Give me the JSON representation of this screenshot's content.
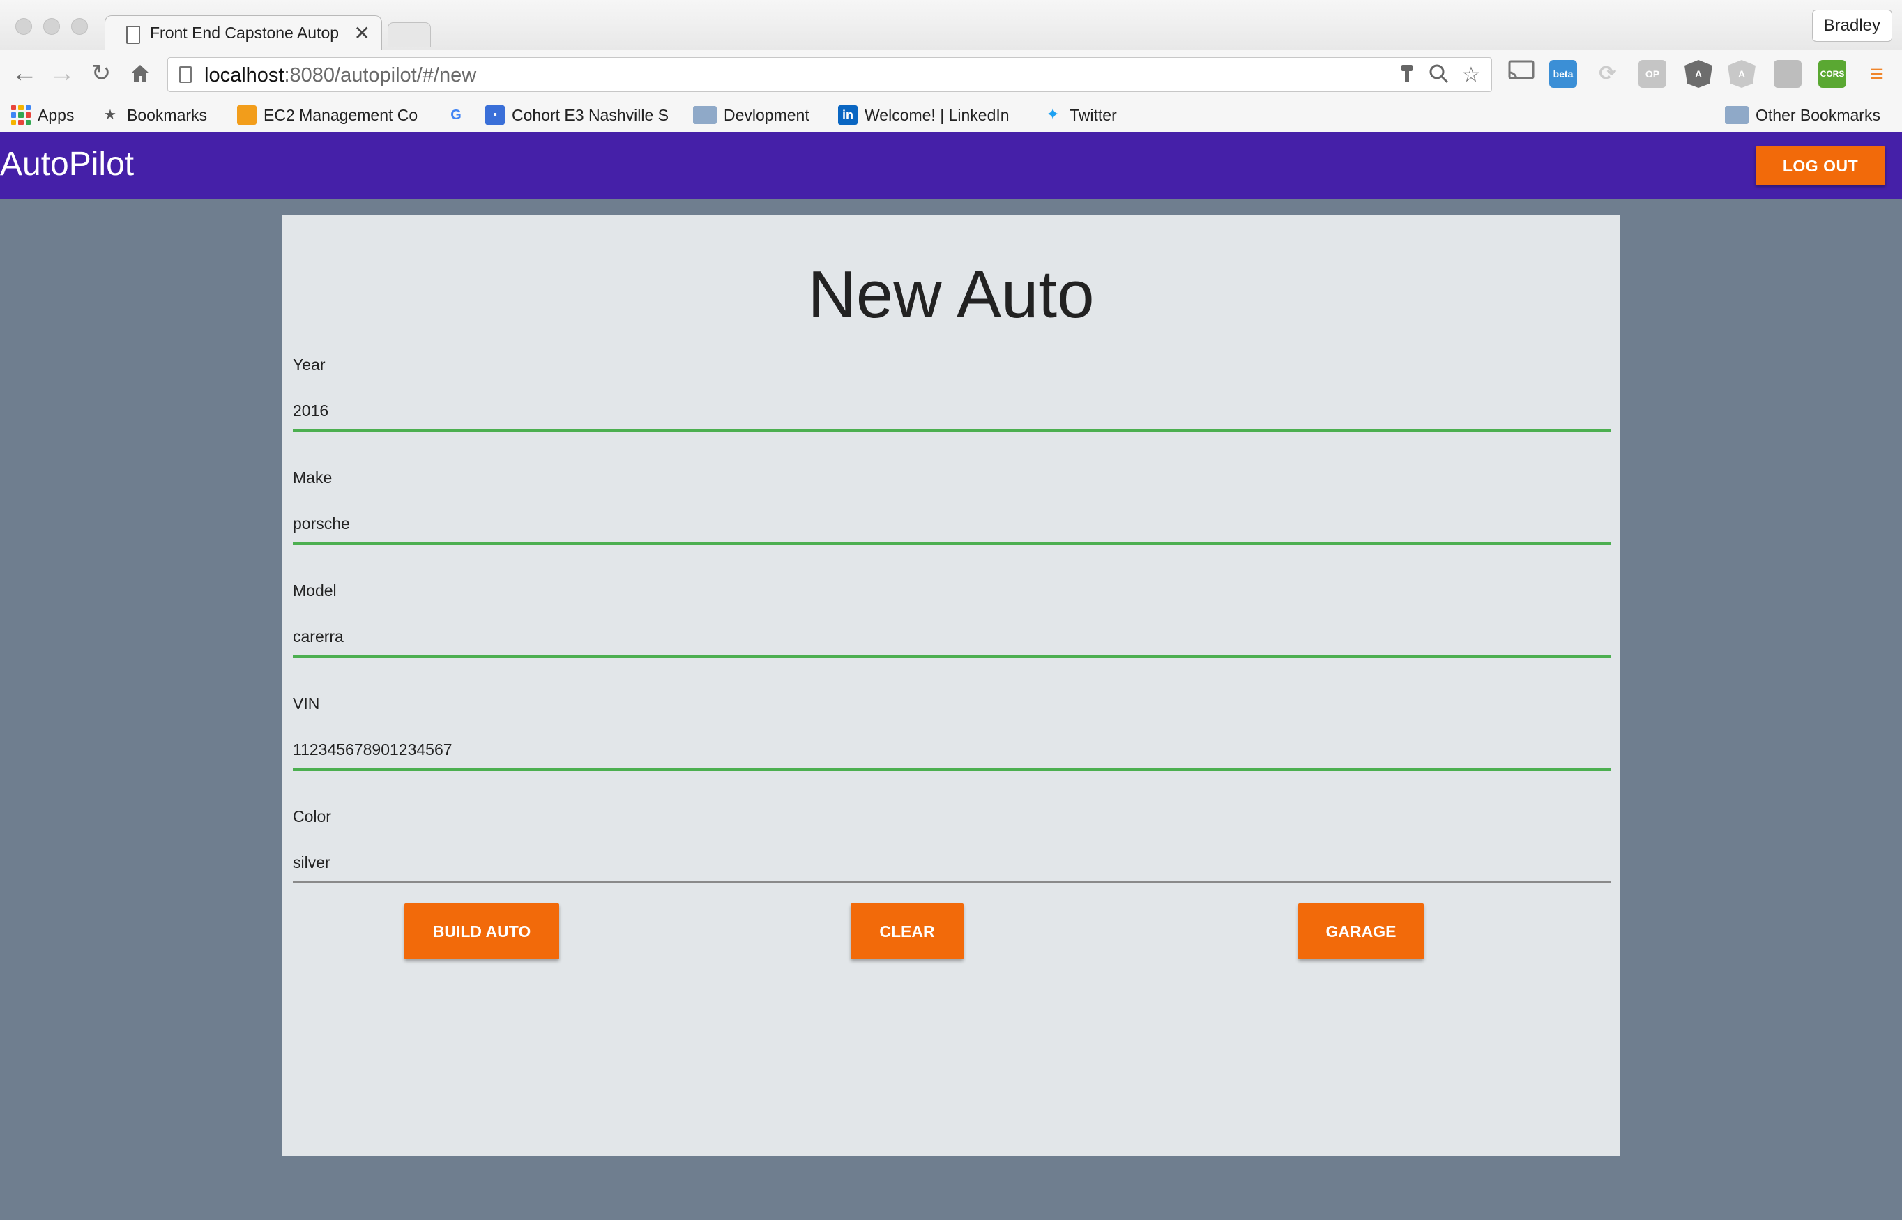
{
  "browser": {
    "tab_title": "Front End Capstone Autopilot",
    "tab_close": "✕",
    "profile_name": "Bradley",
    "url_host": "localhost",
    "url_path": ":8080/autopilot/#/new",
    "bookmarks": [
      {
        "label": "Apps",
        "icon": "apps-grid-icon"
      },
      {
        "label": "Bookmarks",
        "icon": "star-icon"
      },
      {
        "label": "EC2 Management Co",
        "icon": "aws-icon"
      },
      {
        "label": "",
        "icon": "google-icon"
      },
      {
        "label": "Cohort E3 Nashville S",
        "icon": "classroom-icon"
      },
      {
        "label": "Devlopment",
        "icon": "folder-icon"
      },
      {
        "label": "Welcome! | LinkedIn",
        "icon": "linkedin-icon"
      },
      {
        "label": "Twitter",
        "icon": "twitter-icon"
      }
    ],
    "other_bookmarks": "Other Bookmarks",
    "extensions": [
      "cast-icon",
      "beta-extension-icon",
      "sync-icon",
      "op-icon",
      "angular-icon",
      "angular-grey-icon",
      "panel-icon",
      "cors-icon",
      "menu-icon"
    ]
  },
  "app": {
    "brand": "AutoPilot",
    "logout_label": "LOG OUT",
    "page_title": "New Auto",
    "fields": [
      {
        "label": "Year",
        "value": "2016"
      },
      {
        "label": "Make",
        "value": "porsche"
      },
      {
        "label": "Model",
        "value": "carerra"
      },
      {
        "label": "VIN",
        "value": "112345678901234567"
      },
      {
        "label": "Color",
        "value": "silver"
      }
    ],
    "buttons": {
      "build": "BUILD AUTO",
      "clear": "CLEAR",
      "garage": "GARAGE"
    }
  },
  "colors": {
    "appbar": "#4520a8",
    "accent": "#f26a0a",
    "valid_underline": "#4caf50",
    "background": "#6f7e8f",
    "card": "#e2e6e9"
  }
}
